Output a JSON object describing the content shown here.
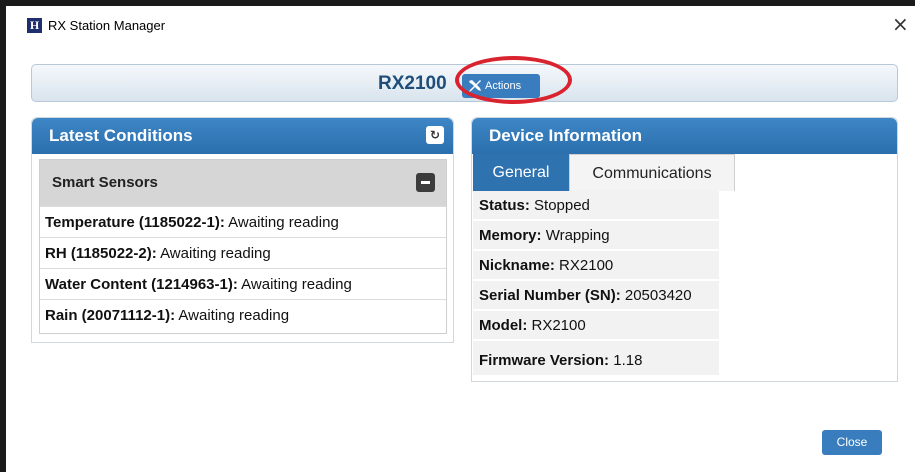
{
  "window": {
    "title": "RX Station Manager",
    "app_icon_letter": "H",
    "close_glyph": "×"
  },
  "header": {
    "device_name": "RX2100",
    "actions_label": "Actions",
    "actions_icon": "tools-icon"
  },
  "latest_conditions": {
    "title": "Latest Conditions",
    "refresh_icon": "refresh-icon",
    "section_title": "Smart Sensors",
    "sensors": [
      {
        "name": "Temperature (1185022-1):",
        "value": "Awaiting reading"
      },
      {
        "name": "RH (1185022-2):",
        "value": "Awaiting reading"
      },
      {
        "name": "Water Content (1214963-1):",
        "value": "Awaiting reading"
      },
      {
        "name": "Rain (20071112-1):",
        "value": "Awaiting reading"
      }
    ]
  },
  "device_info": {
    "title": "Device Information",
    "tabs": [
      {
        "label": "General",
        "active": true
      },
      {
        "label": "Communications",
        "active": false
      }
    ],
    "fields": [
      {
        "label": "Status:",
        "value": "Stopped"
      },
      {
        "label": "Memory:",
        "value": "Wrapping"
      },
      {
        "label": "Nickname:",
        "value": "RX2100"
      },
      {
        "label": "Serial Number (SN):",
        "value": "20503420"
      },
      {
        "label": "Model:",
        "value": "RX2100"
      },
      {
        "label": "Firmware Version:",
        "value": "1.18"
      }
    ]
  },
  "footer": {
    "close_label": "Close"
  },
  "colors": {
    "accent": "#3a7dbf",
    "panel_header": "#2f72b0",
    "highlight_ring": "#d9232f",
    "device_name": "#1e4e79"
  }
}
